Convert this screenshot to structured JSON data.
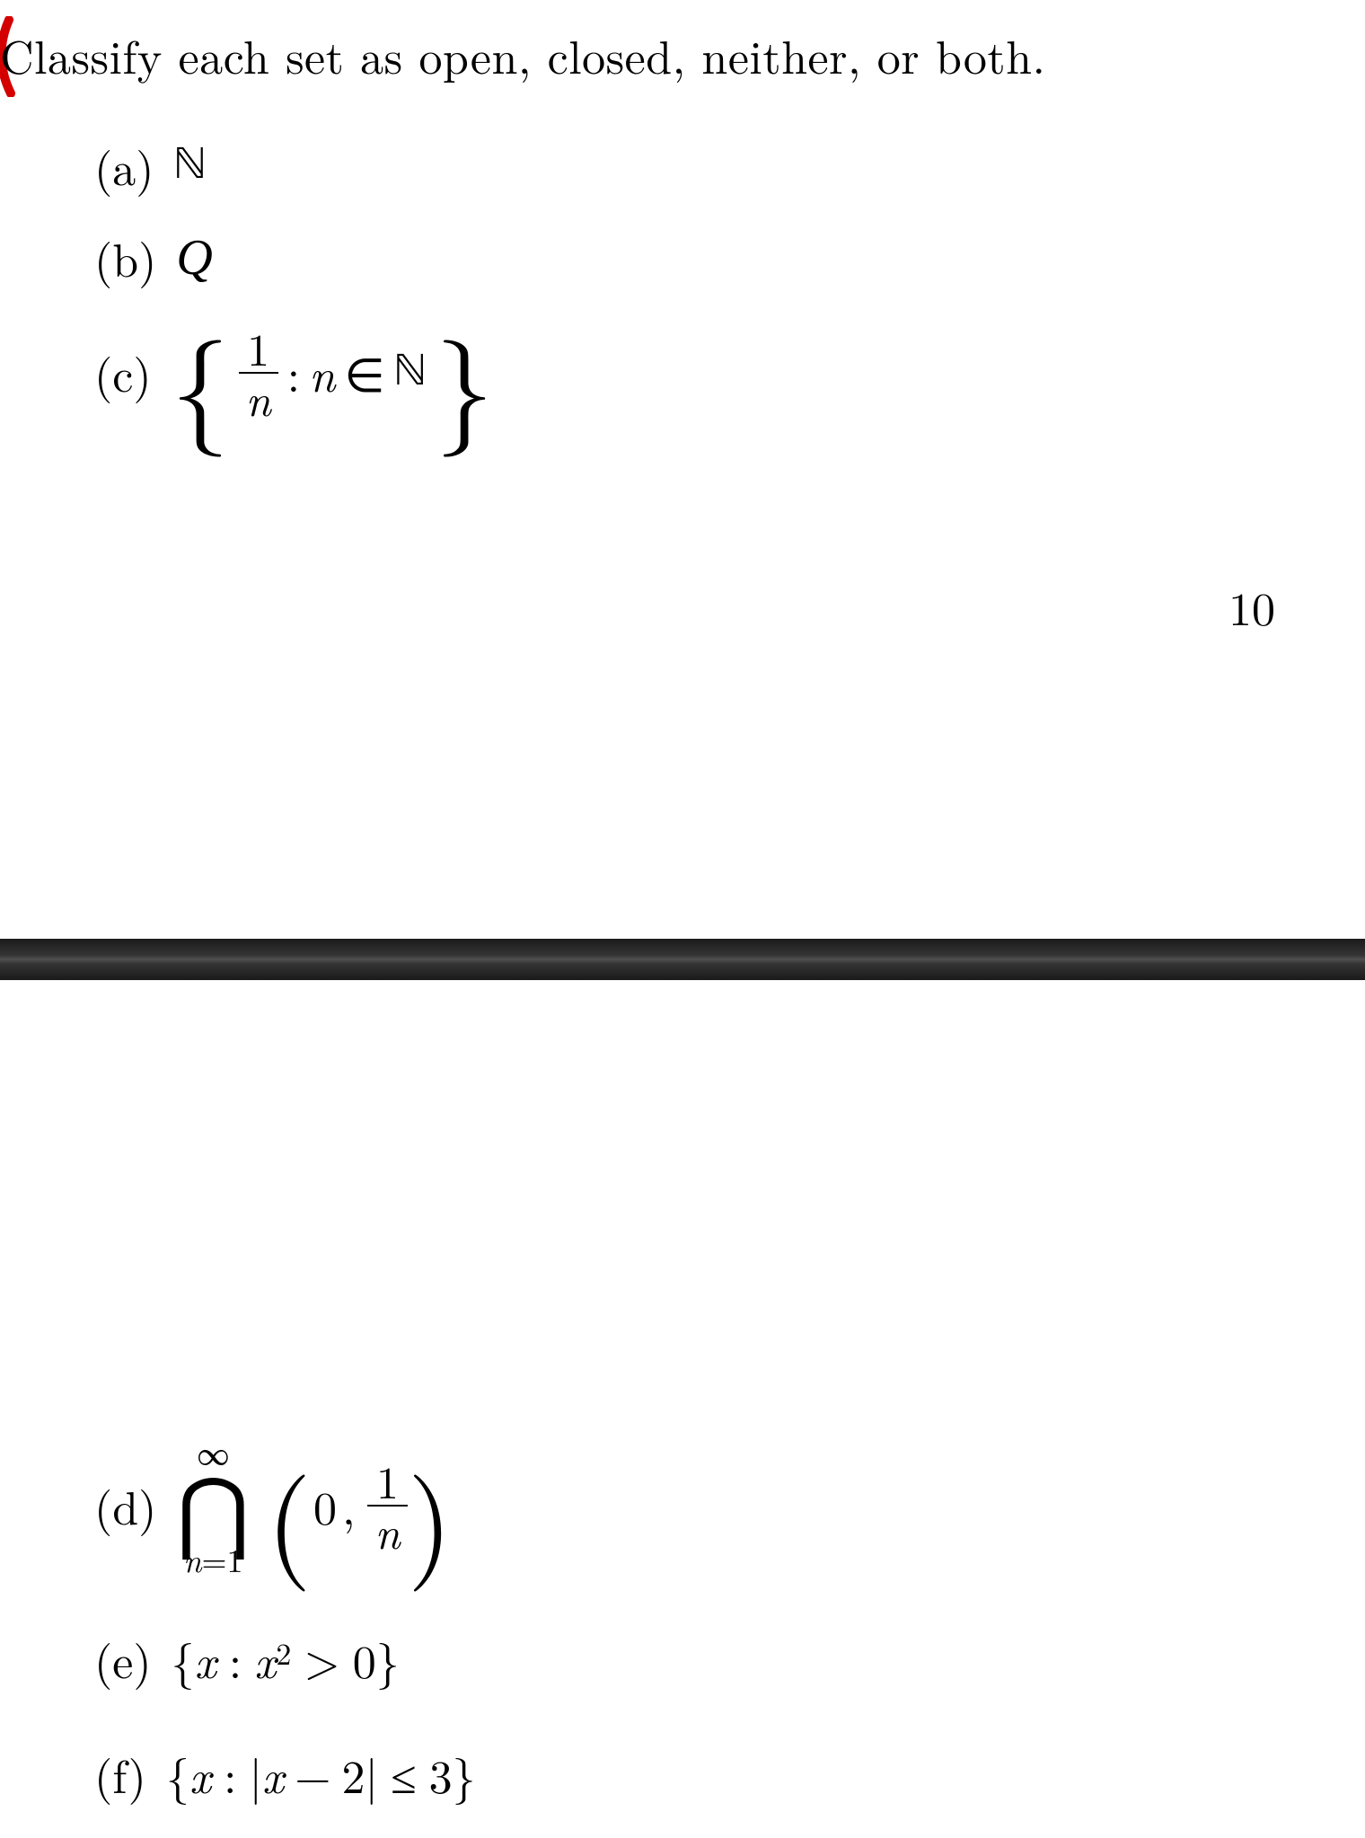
{
  "intro": "Classify each set as open, closed, neither, or both.",
  "page_number": "10",
  "items": {
    "a": {
      "label": "(a)",
      "symbol": "ℕ"
    },
    "b": {
      "label": "(b)",
      "symbol": "Q"
    },
    "c": {
      "label": "(c)",
      "lbrace": "{",
      "rbrace": "}",
      "frac_num": "1",
      "frac_den": "n",
      "colon": ":",
      "n": "n",
      "in": "∈",
      "Nsym": "ℕ"
    },
    "d": {
      "label": "(d)",
      "sup": "∞",
      "sub_lhs": "n",
      "sub_eq": "=",
      "sub_rhs": "1",
      "op": "⋂",
      "lparen": "(",
      "rparen": ")",
      "zero": "0",
      "comma": ",",
      "frac_num": "1",
      "frac_den": "n"
    },
    "e": {
      "label": "(e)",
      "lbrace": "{",
      "rbrace": "}",
      "x": "x",
      "colon": ":",
      "x2_base": "x",
      "x2_exp": "2",
      "gt": ">",
      "zero": "0"
    },
    "f": {
      "label": "(f)",
      "lbrace": "{",
      "rbrace": "}",
      "x": "x",
      "colon": ":",
      "bar1": "|",
      "bar2": "|",
      "x_inner": "x",
      "minus": "−",
      "two": "2",
      "le": "≤",
      "three": "3"
    }
  }
}
